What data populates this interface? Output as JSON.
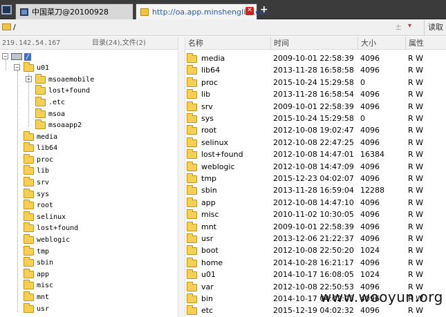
{
  "tabs": [
    {
      "label": "中国菜刀@20100928",
      "active": false
    },
    {
      "label": "http://oa.app.minshenglife.co...",
      "active": true
    }
  ],
  "new_tab_label": "+",
  "address": {
    "path": "/",
    "separator": "±",
    "dropdown": "▾",
    "read_button": "读取"
  },
  "left_header": {
    "ip": "219.142.54.167",
    "counts": "目录(24),文件(2)"
  },
  "columns": {
    "name": "名称",
    "time": "时间",
    "size": "大小",
    "attr": "属性"
  },
  "tree": {
    "root": "/",
    "u01": "u01",
    "u01_children": [
      "msoaemobile",
      "lost+found",
      ".etc",
      "msoa",
      "msoaapp2"
    ],
    "top_dirs": [
      "media",
      "lib64",
      "proc",
      "lib",
      "srv",
      "sys",
      "root",
      "selinux",
      "lost+found",
      "weblogic",
      "tmp",
      "sbin",
      "app",
      "misc",
      "mnt",
      "usr"
    ]
  },
  "files": [
    {
      "name": "media",
      "time": "2009-10-01 22:58:39",
      "size": "4096",
      "attr": "R W"
    },
    {
      "name": "lib64",
      "time": "2013-11-28 16:58:58",
      "size": "4096",
      "attr": "R W"
    },
    {
      "name": "proc",
      "time": "2015-10-24 15:29:58",
      "size": "0",
      "attr": "R W"
    },
    {
      "name": "lib",
      "time": "2013-11-28 16:58:54",
      "size": "4096",
      "attr": "R W"
    },
    {
      "name": "srv",
      "time": "2009-10-01 22:58:39",
      "size": "4096",
      "attr": "R W"
    },
    {
      "name": "sys",
      "time": "2015-10-24 15:29:58",
      "size": "0",
      "attr": "R W"
    },
    {
      "name": "root",
      "time": "2012-10-08 19:02:47",
      "size": "4096",
      "attr": "R W"
    },
    {
      "name": "selinux",
      "time": "2012-10-08 22:47:25",
      "size": "4096",
      "attr": "R W"
    },
    {
      "name": "lost+found",
      "time": "2012-10-08 14:47:01",
      "size": "16384",
      "attr": "R W"
    },
    {
      "name": "weblogic",
      "time": "2012-10-08 14:47:09",
      "size": "4096",
      "attr": "R W"
    },
    {
      "name": "tmp",
      "time": "2015-12-23 04:02:07",
      "size": "4096",
      "attr": "R W"
    },
    {
      "name": "sbin",
      "time": "2013-11-28 16:59:04",
      "size": "12288",
      "attr": "R W"
    },
    {
      "name": "app",
      "time": "2012-10-08 14:47:10",
      "size": "4096",
      "attr": "R W"
    },
    {
      "name": "misc",
      "time": "2010-11-02 10:30:05",
      "size": "4096",
      "attr": "R W"
    },
    {
      "name": "mnt",
      "time": "2009-10-01 22:58:39",
      "size": "4096",
      "attr": "R W"
    },
    {
      "name": "usr",
      "time": "2013-12-06 21:22:37",
      "size": "4096",
      "attr": "R W"
    },
    {
      "name": "boot",
      "time": "2012-10-08 22:50:20",
      "size": "1024",
      "attr": "R W"
    },
    {
      "name": "home",
      "time": "2014-10-28 16:21:17",
      "size": "4096",
      "attr": "R W"
    },
    {
      "name": "u01",
      "time": "2014-10-17 16:08:05",
      "size": "1024",
      "attr": "R W"
    },
    {
      "name": "var",
      "time": "2012-10-08 22:50:53",
      "size": "4096",
      "attr": "R W"
    },
    {
      "name": "bin",
      "time": "2014-10-17 04:02:05",
      "size": "4096",
      "attr": "R W"
    },
    {
      "name": "etc",
      "time": "2015-12-19 04:02:32",
      "size": "4096",
      "attr": "R W"
    }
  ],
  "watermark": "www.wooyun.org"
}
